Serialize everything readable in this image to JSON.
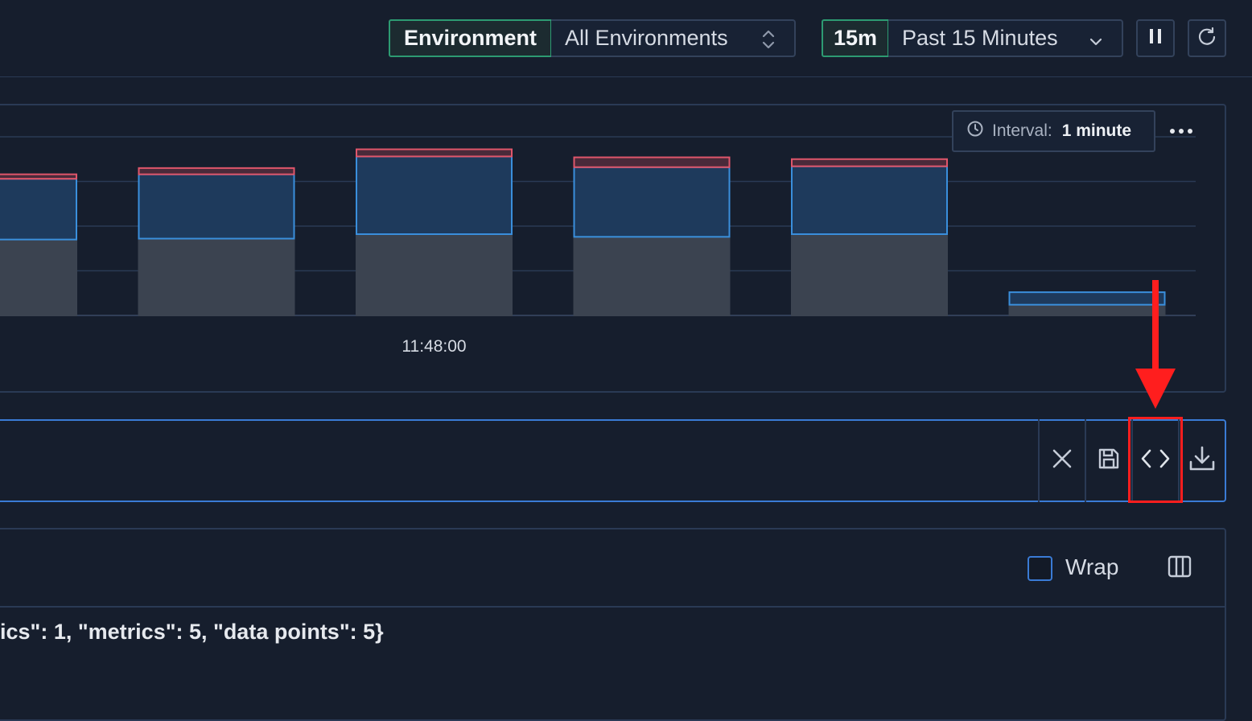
{
  "header": {
    "environment_label": "Environment",
    "environment_value": "All Environments",
    "time_range_short": "15m",
    "time_range_value": "Past 15 Minutes",
    "pause_icon": "pause-icon",
    "refresh_icon": "refresh-icon"
  },
  "chart": {
    "interval_label": "Interval:",
    "interval_value": "1 minute",
    "more_icon": "more-horizontal-icon"
  },
  "chart_data": {
    "type": "bar",
    "stacked": true,
    "categories": [
      "",
      "",
      "11:48:00",
      "",
      "",
      ""
    ],
    "x_tick_labels": [
      "11:48:00"
    ],
    "series": [
      {
        "values": [
          85,
          86,
          91,
          88,
          91,
          12
        ],
        "color": "#3b4350"
      },
      {
        "values": [
          68,
          72,
          87,
          78,
          76,
          14
        ],
        "color": "#3a8fdc"
      },
      {
        "values": [
          5,
          7,
          8,
          11,
          8,
          0
        ],
        "color": "#e0566b"
      }
    ],
    "ylim": [
      0,
      200
    ],
    "grid": true
  },
  "query_bar": {
    "close_icon": "close-icon",
    "save_icon": "save-icon",
    "code_icon": "code-icon",
    "download_icon": "download-icon"
  },
  "results": {
    "wrap_label": "Wrap",
    "columns_icon": "columns-icon",
    "line": "ics\": 1, \"metrics\": 5, \"data points\": 5}"
  },
  "colors": {
    "background": "#161e2d",
    "accent_green": "#2d9b72",
    "accent_blue": "#3a7bd5",
    "annotation_red": "#ff1e1e"
  }
}
